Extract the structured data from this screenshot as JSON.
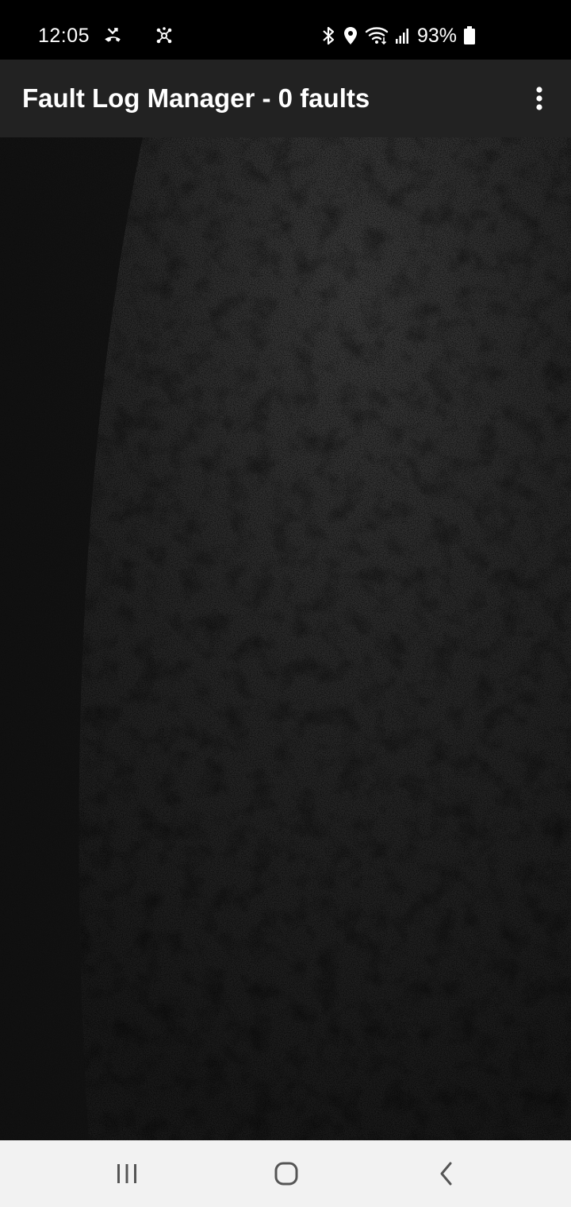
{
  "status_bar": {
    "time": "12:05",
    "battery_percent": "93%",
    "icons": [
      "missed-call-icon",
      "network-hub-icon",
      "bluetooth-icon",
      "location-icon",
      "wifi-icon",
      "signal-icon",
      "battery-icon"
    ]
  },
  "app_bar": {
    "title": "Fault Log Manager - 0 faults",
    "menu_icon": "more-vert-icon"
  },
  "nav_bar": {
    "icons": [
      "recent-apps-icon",
      "home-icon",
      "back-icon"
    ]
  },
  "colors": {
    "status_bar_bg": "#000000",
    "app_bar_bg": "#222222",
    "content_bg": "#141414",
    "nav_bar_bg": "#f2f2f2"
  }
}
